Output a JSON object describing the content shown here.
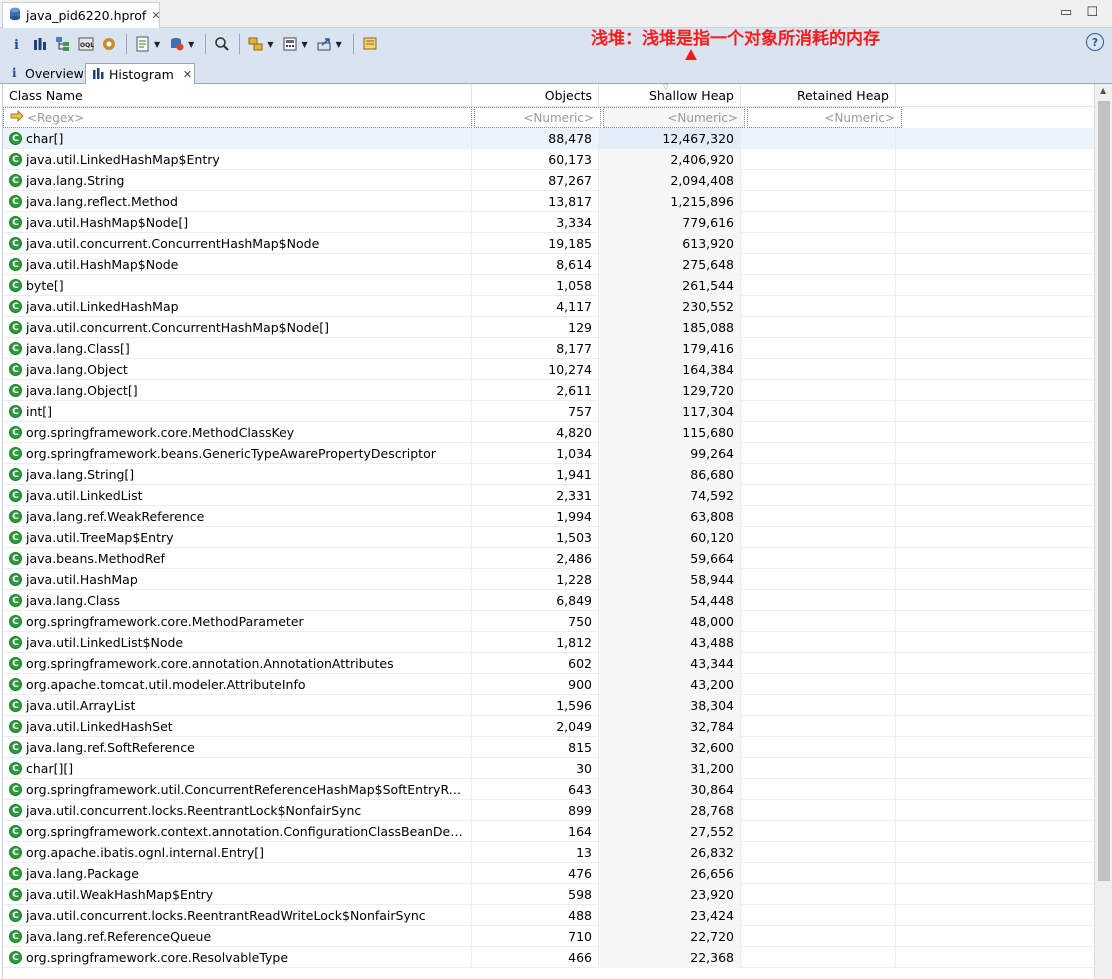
{
  "editor": {
    "tab_title": "java_pid6220.hprof",
    "close_glyph": "✕",
    "minimize_glyph": "▭",
    "maximize_glyph": "☐"
  },
  "toolbar": {
    "help_label": "?"
  },
  "annotation": {
    "text": "浅堆：浅堆是指一个对象所消耗的内存",
    "color": "#ff1a1a"
  },
  "view_tabs": [
    {
      "label": "Overview",
      "icon": "info-icon"
    },
    {
      "label": "Histogram",
      "icon": "histogram-icon",
      "active": true
    }
  ],
  "table": {
    "columns": [
      "Class Name",
      "Objects",
      "Shallow Heap",
      "Retained Heap"
    ],
    "filters": [
      "<Regex>",
      "<Numeric>",
      "<Numeric>",
      "<Numeric>"
    ],
    "rows": [
      {
        "name": "char[]",
        "objects": "88,478",
        "shallow": "12,467,320"
      },
      {
        "name": "java.util.LinkedHashMap$Entry",
        "objects": "60,173",
        "shallow": "2,406,920"
      },
      {
        "name": "java.lang.String",
        "objects": "87,267",
        "shallow": "2,094,408"
      },
      {
        "name": "java.lang.reflect.Method",
        "objects": "13,817",
        "shallow": "1,215,896"
      },
      {
        "name": "java.util.HashMap$Node[]",
        "objects": "3,334",
        "shallow": "779,616"
      },
      {
        "name": "java.util.concurrent.ConcurrentHashMap$Node",
        "objects": "19,185",
        "shallow": "613,920"
      },
      {
        "name": "java.util.HashMap$Node",
        "objects": "8,614",
        "shallow": "275,648"
      },
      {
        "name": "byte[]",
        "objects": "1,058",
        "shallow": "261,544"
      },
      {
        "name": "java.util.LinkedHashMap",
        "objects": "4,117",
        "shallow": "230,552"
      },
      {
        "name": "java.util.concurrent.ConcurrentHashMap$Node[]",
        "objects": "129",
        "shallow": "185,088"
      },
      {
        "name": "java.lang.Class[]",
        "objects": "8,177",
        "shallow": "179,416"
      },
      {
        "name": "java.lang.Object",
        "objects": "10,274",
        "shallow": "164,384"
      },
      {
        "name": "java.lang.Object[]",
        "objects": "2,611",
        "shallow": "129,720"
      },
      {
        "name": "int[]",
        "objects": "757",
        "shallow": "117,304"
      },
      {
        "name": "org.springframework.core.MethodClassKey",
        "objects": "4,820",
        "shallow": "115,680"
      },
      {
        "name": "org.springframework.beans.GenericTypeAwarePropertyDescriptor",
        "objects": "1,034",
        "shallow": "99,264"
      },
      {
        "name": "java.lang.String[]",
        "objects": "1,941",
        "shallow": "86,680"
      },
      {
        "name": "java.util.LinkedList",
        "objects": "2,331",
        "shallow": "74,592"
      },
      {
        "name": "java.lang.ref.WeakReference",
        "objects": "1,994",
        "shallow": "63,808"
      },
      {
        "name": "java.util.TreeMap$Entry",
        "objects": "1,503",
        "shallow": "60,120"
      },
      {
        "name": "java.beans.MethodRef",
        "objects": "2,486",
        "shallow": "59,664"
      },
      {
        "name": "java.util.HashMap",
        "objects": "1,228",
        "shallow": "58,944"
      },
      {
        "name": "java.lang.Class",
        "objects": "6,849",
        "shallow": "54,448"
      },
      {
        "name": "org.springframework.core.MethodParameter",
        "objects": "750",
        "shallow": "48,000"
      },
      {
        "name": "java.util.LinkedList$Node",
        "objects": "1,812",
        "shallow": "43,488"
      },
      {
        "name": "org.springframework.core.annotation.AnnotationAttributes",
        "objects": "602",
        "shallow": "43,344"
      },
      {
        "name": "org.apache.tomcat.util.modeler.AttributeInfo",
        "objects": "900",
        "shallow": "43,200"
      },
      {
        "name": "java.util.ArrayList",
        "objects": "1,596",
        "shallow": "38,304"
      },
      {
        "name": "java.util.LinkedHashSet",
        "objects": "2,049",
        "shallow": "32,784"
      },
      {
        "name": "java.lang.ref.SoftReference",
        "objects": "815",
        "shallow": "32,600"
      },
      {
        "name": "char[][]",
        "objects": "30",
        "shallow": "31,200"
      },
      {
        "name": "org.springframework.util.ConcurrentReferenceHashMap$SoftEntryReferen...",
        "objects": "643",
        "shallow": "30,864"
      },
      {
        "name": "java.util.concurrent.locks.ReentrantLock$NonfairSync",
        "objects": "899",
        "shallow": "28,768"
      },
      {
        "name": "org.springframework.context.annotation.ConfigurationClassBeanDefinition...",
        "objects": "164",
        "shallow": "27,552"
      },
      {
        "name": "org.apache.ibatis.ognl.internal.Entry[]",
        "objects": "13",
        "shallow": "26,832"
      },
      {
        "name": "java.lang.Package",
        "objects": "476",
        "shallow": "26,656"
      },
      {
        "name": "java.util.WeakHashMap$Entry",
        "objects": "598",
        "shallow": "23,920"
      },
      {
        "name": "java.util.concurrent.locks.ReentrantReadWriteLock$NonfairSync",
        "objects": "488",
        "shallow": "23,424"
      },
      {
        "name": "java.lang.ref.ReferenceQueue",
        "objects": "710",
        "shallow": "22,720"
      },
      {
        "name": "org.springframework.core.ResolvableType",
        "objects": "466",
        "shallow": "22,368"
      }
    ]
  }
}
